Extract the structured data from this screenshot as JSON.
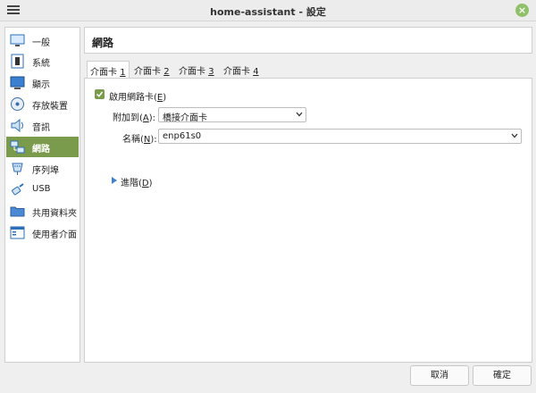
{
  "window": {
    "title": "home-assistant - 設定"
  },
  "sidebar": {
    "items": [
      {
        "label": "一般"
      },
      {
        "label": "系統"
      },
      {
        "label": "顯示"
      },
      {
        "label": "存放裝置"
      },
      {
        "label": "音訊"
      },
      {
        "label": "網路",
        "active": true
      },
      {
        "label": "序列埠"
      },
      {
        "label": "USB"
      },
      {
        "label": "共用資料夾"
      },
      {
        "label": "使用者介面"
      }
    ]
  },
  "content": {
    "title": "網路",
    "tabs": [
      {
        "label": "介面卡 ",
        "key": "1"
      },
      {
        "label": "介面卡 ",
        "key": "2"
      },
      {
        "label": "介面卡 ",
        "key": "3"
      },
      {
        "label": "介面卡 ",
        "key": "4"
      }
    ],
    "enable_label": "啟用網路卡(",
    "enable_key": "E",
    "enable_suffix": ")",
    "attached_label_pre": "附加到(",
    "attached_key": "A",
    "attached_label_post": "):",
    "attached_value": "橋接介面卡",
    "name_label_pre": "名稱(",
    "name_key": "N",
    "name_label_post": "):",
    "name_value": "enp61s0",
    "advanced_pre": "進階(",
    "advanced_key": "D",
    "advanced_post": ")"
  },
  "footer": {
    "cancel_label": "取消",
    "ok_label": "確定"
  },
  "colors": {
    "accent": "#7a9b4c",
    "link_arrow": "#3b7fd6"
  }
}
